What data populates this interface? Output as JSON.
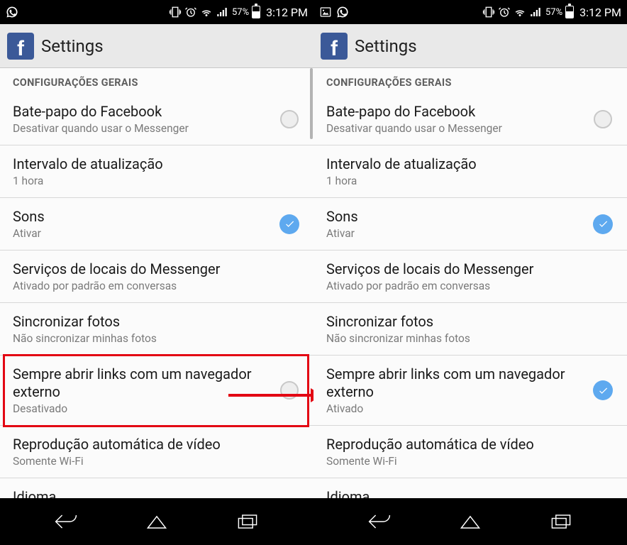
{
  "statusbar": {
    "battery_text": "57%",
    "time": "3:12 PM"
  },
  "header": {
    "title": "Settings"
  },
  "section_header": "CONFIGURAÇÕES GERAIS",
  "left": {
    "items": [
      {
        "title": "Bate-papo do Facebook",
        "sub": "Desativar quando usar o Messenger",
        "ctrl": "radio_off"
      },
      {
        "title": "Intervalo de atualização",
        "sub": "1 hora",
        "ctrl": "none"
      },
      {
        "title": "Sons",
        "sub": "Ativar",
        "ctrl": "radio_on"
      },
      {
        "title": "Serviços de locais do Messenger",
        "sub": "Ativado por padrão em conversas",
        "ctrl": "none"
      },
      {
        "title": "Sincronizar fotos",
        "sub": "Não sincronizar minhas fotos",
        "ctrl": "none"
      },
      {
        "title": "Sempre abrir links com um navegador externo",
        "sub": "Desativado",
        "ctrl": "radio_off"
      },
      {
        "title": "Reprodução automática de vídeo",
        "sub": "Somente Wi-Fi",
        "ctrl": "none"
      },
      {
        "title": "Idioma",
        "sub": "",
        "ctrl": "none"
      }
    ],
    "highlight_index": 5
  },
  "right": {
    "items": [
      {
        "title": "Bate-papo do Facebook",
        "sub": "Desativar quando usar o Messenger",
        "ctrl": "radio_off"
      },
      {
        "title": "Intervalo de atualização",
        "sub": "1 hora",
        "ctrl": "none"
      },
      {
        "title": "Sons",
        "sub": "Ativar",
        "ctrl": "radio_on"
      },
      {
        "title": "Serviços de locais do Messenger",
        "sub": "Ativado por padrão em conversas",
        "ctrl": "none"
      },
      {
        "title": "Sincronizar fotos",
        "sub": "Não sincronizar minhas fotos",
        "ctrl": "none"
      },
      {
        "title": "Sempre abrir links com um navegador externo",
        "sub": "Ativado",
        "ctrl": "radio_on"
      },
      {
        "title": "Reprodução automática de vídeo",
        "sub": "Somente Wi-Fi",
        "ctrl": "none"
      },
      {
        "title": "Idioma",
        "sub": "",
        "ctrl": "none"
      }
    ]
  }
}
